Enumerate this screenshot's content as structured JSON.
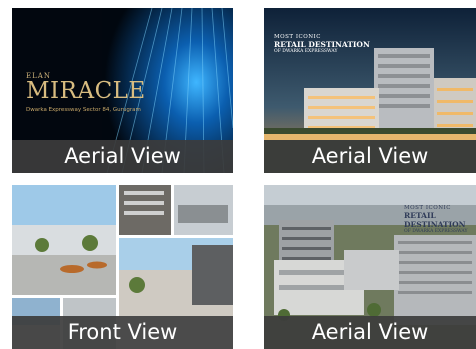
{
  "tiles": [
    {
      "caption": "Aerial View",
      "logo_small": "ELAN",
      "logo_main": "MIRACLE",
      "logo_sub": "Dwarka Expressway Sector 84, Gurugram"
    },
    {
      "caption": "Aerial View",
      "overlay_line1": "MOST ICONIC",
      "overlay_line2": "RETAIL DESTINATION",
      "overlay_line3": "OF DWARKA EXPRESSWAY"
    },
    {
      "caption": "Front View"
    },
    {
      "caption": "Aerial View",
      "overlay_line1": "MOST ICONIC",
      "overlay_line2": "RETAIL DESTINATION",
      "overlay_line3": "OF DWARKA EXPRESSWAY"
    }
  ]
}
